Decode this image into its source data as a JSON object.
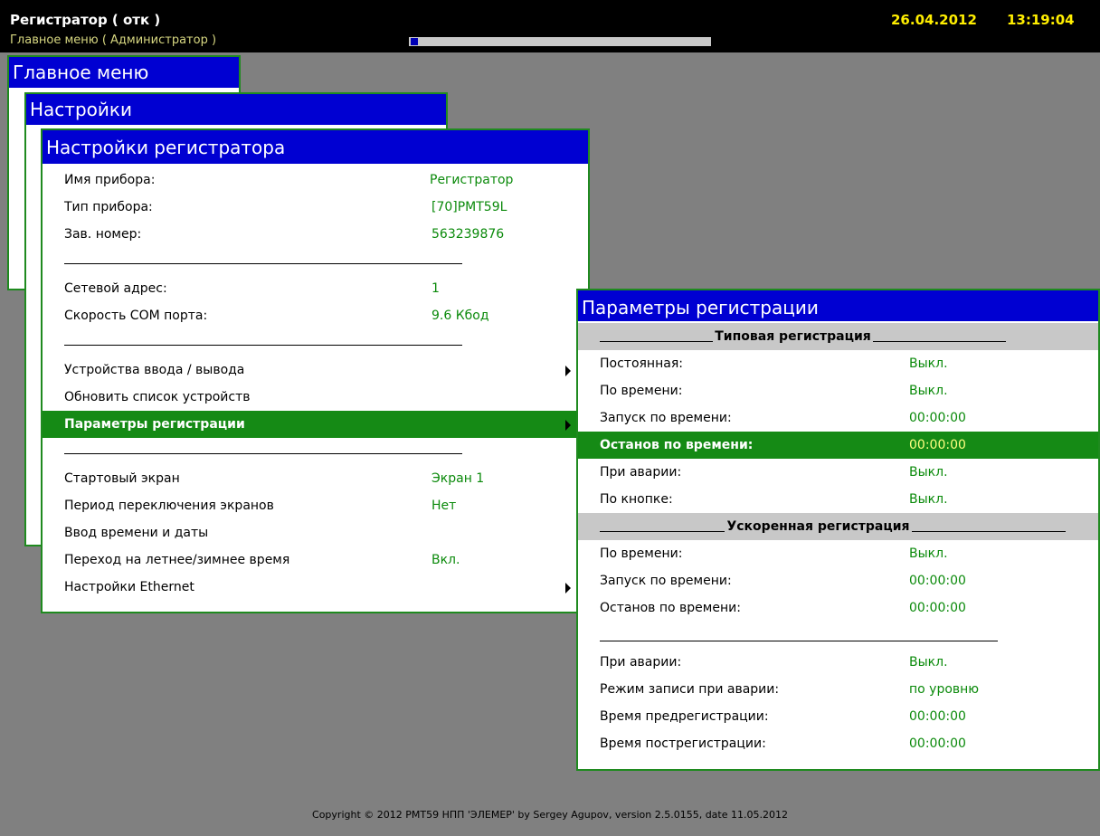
{
  "app": {
    "title": "Регистратор ( отк )",
    "subtitle": "Главное меню ( Администратор )",
    "date": "26.04.2012",
    "time": "13:19:04"
  },
  "windows": {
    "main_menu": "Главное меню",
    "settings": "Настройки",
    "recorder_settings": "Настройки регистратора",
    "reg_params": "Параметры регистрации"
  },
  "recorder_settings": {
    "items": [
      {
        "label": "Имя прибора:",
        "value": "Регистратор"
      },
      {
        "label": "Тип прибора:",
        "value": "[70]PMT59L"
      },
      {
        "label": "Зав. номер:",
        "value": "563239876"
      },
      {
        "label": "Сетевой адрес:",
        "value": "1"
      },
      {
        "label": "Скорость COM порта:",
        "value": "9.6 Кбод"
      },
      {
        "label": "Устройства ввода / вывода"
      },
      {
        "label": "Обновить список устройств"
      },
      {
        "label": "Параметры регистрации"
      },
      {
        "label": "Стартовый экран",
        "value": "Экран 1"
      },
      {
        "label": "Период переключения экранов",
        "value": "Нет"
      },
      {
        "label": "Ввод времени и даты"
      },
      {
        "label": "Переход на летнее/зимнее время",
        "value": "Вкл."
      },
      {
        "label": "Настройки Ethernet"
      }
    ]
  },
  "reg_params": {
    "header_typical": "Типовая регистрация",
    "header_fast": "Ускоренная регистрация",
    "items": [
      {
        "label": "Постоянная:",
        "value": "Выкл."
      },
      {
        "label": "По времени:",
        "value": "Выкл."
      },
      {
        "label": "Запуск по времени:",
        "value": "00:00:00"
      },
      {
        "label": "Останов по времени:",
        "value": "00:00:00"
      },
      {
        "label": "При аварии:",
        "value": "Выкл."
      },
      {
        "label": "По кнопке:",
        "value": "Выкл."
      },
      {
        "label": "По времени:",
        "value": "Выкл."
      },
      {
        "label": "Запуск по времени:",
        "value": "00:00:00"
      },
      {
        "label": "Останов по времени:",
        "value": "00:00:00"
      },
      {
        "label": "При аварии:",
        "value": "Выкл."
      },
      {
        "label": "Режим записи при аварии:",
        "value": "по уровню"
      },
      {
        "label": "Время предрегистрации:",
        "value": "00:00:00"
      },
      {
        "label": "Время пострегистрации:",
        "value": "00:00:00"
      }
    ]
  },
  "progress": {
    "fraction": 0.02
  },
  "footer": {
    "copyright": "Copyright © 2012 PMT59 НПП 'ЭЛЕМЕР' by Sergey Agupov, version 2.5.0155, date 11.05.2012"
  },
  "colors": {
    "title_bar": "#0000d2",
    "selection": "#158a15",
    "value": "#0b8a0b",
    "clock": "#ffee00"
  }
}
